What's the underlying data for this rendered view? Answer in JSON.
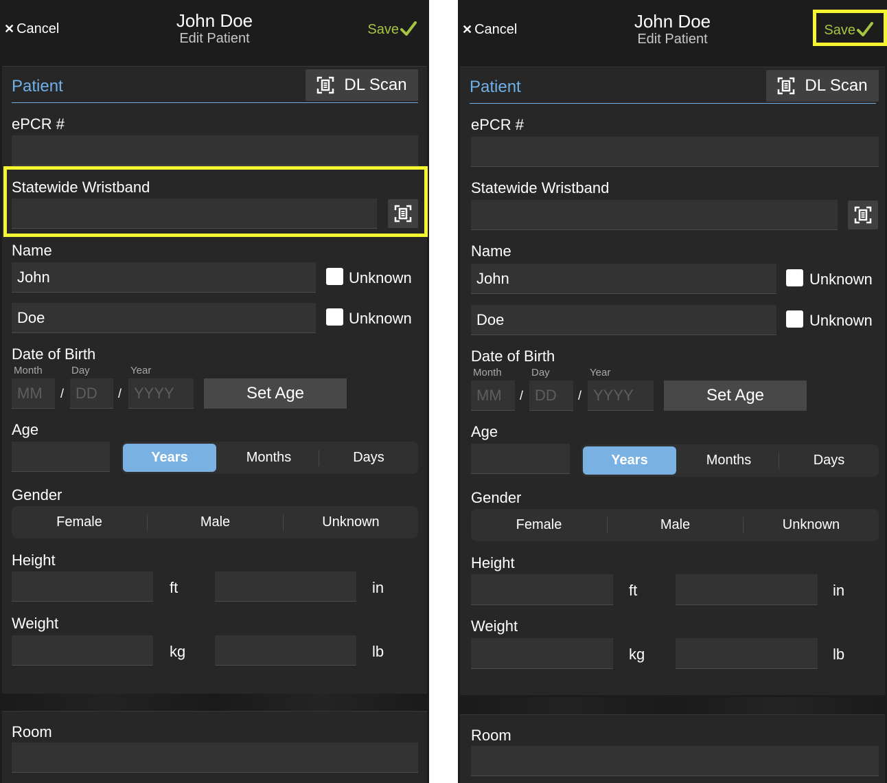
{
  "screens": [
    {
      "header": {
        "cancel_label": "Cancel",
        "title": "John Doe",
        "subtitle": "Edit Patient",
        "save_label": "Save"
      },
      "section": {
        "title": "Patient",
        "dl_scan_label": "DL Scan"
      },
      "epcr": {
        "label": "ePCR #",
        "value": ""
      },
      "wristband": {
        "label": "Statewide Wristband",
        "value": ""
      },
      "name": {
        "label": "Name",
        "first": "John",
        "last": "Doe",
        "first_unknown_label": "Unknown",
        "last_unknown_label": "Unknown"
      },
      "dob": {
        "label": "Date of Birth",
        "month_label": "Month",
        "day_label": "Day",
        "year_label": "Year",
        "month_placeholder": "MM",
        "day_placeholder": "DD",
        "year_placeholder": "YYYY",
        "separator": "/",
        "set_age_label": "Set Age"
      },
      "age": {
        "label": "Age",
        "value": "",
        "units": [
          "Years",
          "Months",
          "Days"
        ],
        "selected": "Years"
      },
      "gender": {
        "label": "Gender",
        "options": [
          "Female",
          "Male",
          "Unknown"
        ]
      },
      "height": {
        "label": "Height",
        "unit1": "ft",
        "unit2": "in"
      },
      "weight": {
        "label": "Weight",
        "unit1": "kg",
        "unit2": "lb"
      },
      "room": {
        "label": "Room",
        "value": ""
      },
      "highlighted": "statewide-wristband-group"
    },
    {
      "header": {
        "cancel_label": "Cancel",
        "title": "John Doe",
        "subtitle": "Edit Patient",
        "save_label": "Save"
      },
      "section": {
        "title": "Patient",
        "dl_scan_label": "DL Scan"
      },
      "epcr": {
        "label": "ePCR #",
        "value": ""
      },
      "wristband": {
        "label": "Statewide Wristband",
        "value": ""
      },
      "name": {
        "label": "Name",
        "first": "John",
        "last": "Doe",
        "first_unknown_label": "Unknown",
        "last_unknown_label": "Unknown"
      },
      "dob": {
        "label": "Date of Birth",
        "month_label": "Month",
        "day_label": "Day",
        "year_label": "Year",
        "month_placeholder": "MM",
        "day_placeholder": "DD",
        "year_placeholder": "YYYY",
        "separator": "/",
        "set_age_label": "Set Age"
      },
      "age": {
        "label": "Age",
        "value": "",
        "units": [
          "Years",
          "Months",
          "Days"
        ],
        "selected": "Years"
      },
      "gender": {
        "label": "Gender",
        "options": [
          "Female",
          "Male",
          "Unknown"
        ]
      },
      "height": {
        "label": "Height",
        "unit1": "ft",
        "unit2": "in"
      },
      "weight": {
        "label": "Weight",
        "unit1": "kg",
        "unit2": "lb"
      },
      "room": {
        "label": "Room",
        "value": ""
      },
      "highlighted": "save-button"
    }
  ],
  "colors": {
    "accent_blue": "#6fb0e8",
    "save_green": "#a6c444",
    "highlight_yellow": "#f5f531",
    "background": "#1c1c1c"
  }
}
